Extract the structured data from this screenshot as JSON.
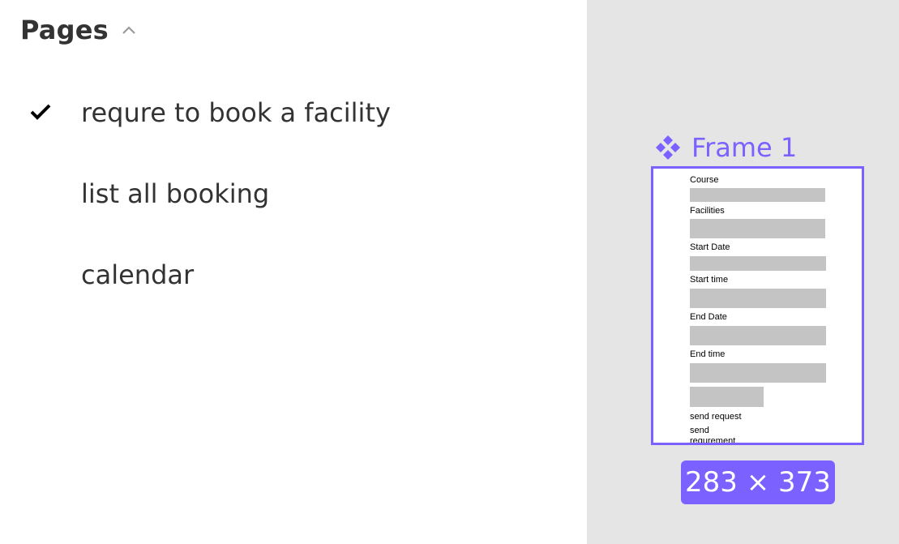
{
  "pages_panel": {
    "title": "Pages",
    "items": [
      {
        "label": "requre to book a facility",
        "active": true
      },
      {
        "label": "list all booking",
        "active": false
      },
      {
        "label": "calendar",
        "active": false
      }
    ]
  },
  "canvas": {
    "frame_name": "Frame 1",
    "size_badge": "283 × 373",
    "frame_fields": {
      "course": "Course",
      "facilities": "Facilities",
      "start_date": "Start Date",
      "start_time": "Start time",
      "end_date": "End Date",
      "end_time": "End time",
      "send_request": "send request",
      "send_requrement": "send requrement"
    }
  },
  "colors": {
    "accent": "#7b61ff",
    "canvas_bg": "#e5e5e5",
    "placeholder_box": "#c4c4c4"
  }
}
